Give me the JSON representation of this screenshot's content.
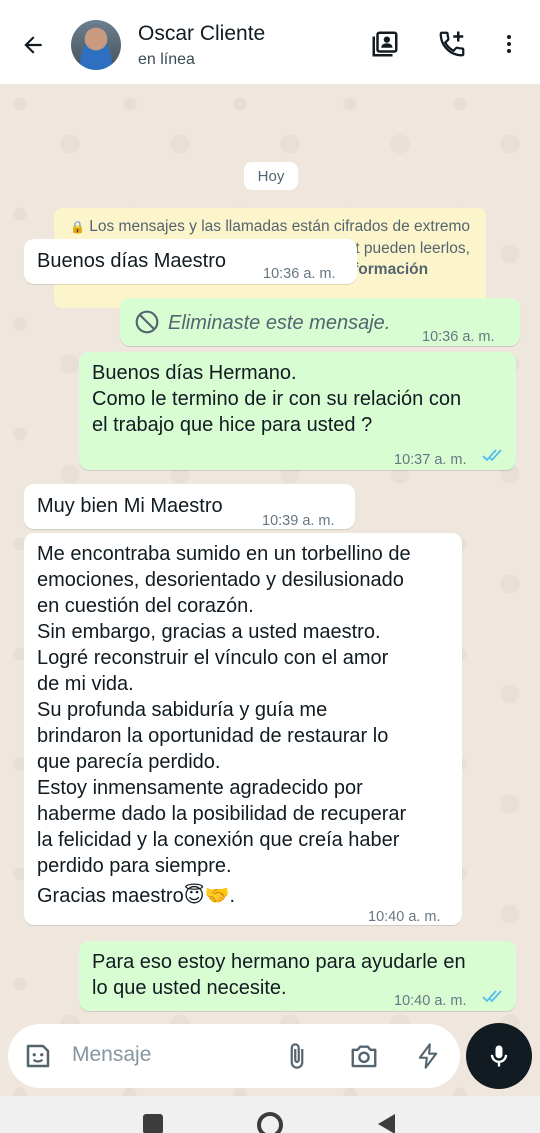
{
  "header": {
    "contact_name": "Oscar Cliente",
    "status": "en línea",
    "icons": [
      "back-arrow-icon",
      "contact-card-icon",
      "add-call-icon",
      "more-vert-icon"
    ]
  },
  "chat": {
    "date_label": "Hoy",
    "encryption_notice": "Los mensajes y las llamadas están cifrados de extremo a extremo. Solo las personas en este chat pueden leerlos, escucharlos o compartirlos.",
    "encryption_link": "Más información",
    "messages": [
      {
        "direction": "in",
        "text": "Buenos días Maestro",
        "time": "10:36 a. m."
      },
      {
        "direction": "out",
        "text": "Eliminaste este mensaje.",
        "time": "10:36 a. m.",
        "deleted": true
      },
      {
        "direction": "out",
        "text": "Buenos días Hermano.\nComo le termino de ir con su relación con\nel trabajo que hice para usted ?",
        "time": "10:37 a. m.",
        "read": true
      },
      {
        "direction": "in",
        "text": "Muy bien Mi Maestro",
        "time": "10:39 a. m."
      },
      {
        "direction": "in",
        "text": "Me encontraba sumido en un torbellino de\nemociones, desorientado y desilusionado\nen cuestión del corazón.\nSin embargo, gracias a usted maestro.\nLogré reconstruir el vínculo con el amor\nde mi vida.\nSu profunda sabiduría y guía me\nbrindaron la oportunidad de restaurar lo\nque parecía perdido.\nEstoy inmensamente agradecido por\nhaberme dado la posibilidad de recuperar\nla felicidad y la conexión que creía haber\nperdido para siempre.",
        "closing": "Gracias maestro😇🤝.",
        "time": "10:40 a. m."
      },
      {
        "direction": "out",
        "text": "Para eso estoy hermano para ayudarle en\nlo que usted necesite.",
        "time": "10:40 a. m.",
        "read": true
      }
    ]
  },
  "composer": {
    "placeholder": "Mensaje",
    "icons": [
      "sticker-icon",
      "attach-icon",
      "camera-icon",
      "quick-reply-icon",
      "mic-icon"
    ]
  },
  "colors": {
    "incoming_bubble": "#ffffff",
    "outgoing_bubble": "#d9fdd3",
    "read_ticks": "#53bdeb",
    "notice_bg": "#fcf4cb"
  }
}
